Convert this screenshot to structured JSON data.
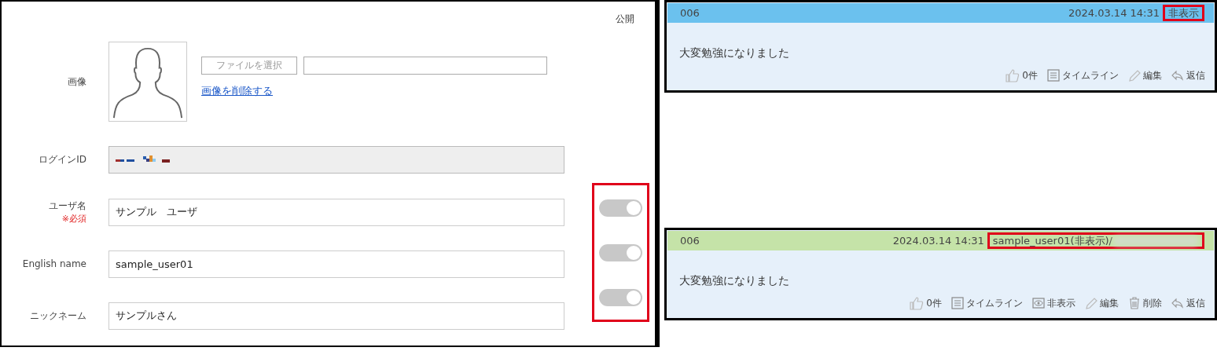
{
  "profile": {
    "public_header": "公開",
    "toggles_highlighted": true,
    "fields": [
      {
        "kind": "image",
        "label": "画像",
        "file_button": "ファイルを選択",
        "delete_link": "画像を削除する"
      },
      {
        "kind": "masked",
        "label": "ログインID"
      },
      {
        "kind": "text",
        "label": "ユーザ名",
        "required": "※必須",
        "value": "サンプル　ユーザ",
        "public": true
      },
      {
        "kind": "text",
        "label": "English name",
        "value": "sample_user01",
        "public": true
      },
      {
        "kind": "text",
        "label": "ニックネーム",
        "value": "サンプルさん",
        "public": true
      }
    ]
  },
  "posts": [
    {
      "number": "006",
      "color": "#6bc1ee",
      "datetime": "2024.03.14 14:31",
      "tag": {
        "text": "非表示",
        "highlighted": true,
        "blurred_suffix": false
      },
      "message": "大変勉強になりました",
      "actions": [
        {
          "kind": "like",
          "label": "0件"
        },
        {
          "kind": "timeline",
          "label": "タイムライン"
        },
        {
          "kind": "edit",
          "label": "編集"
        },
        {
          "kind": "reply",
          "label": "返信"
        }
      ]
    },
    {
      "number": "006",
      "color": "#c5e3a8",
      "datetime": "2024.03.14 14:31",
      "tag": {
        "text": "sample_user01(非表示)/",
        "highlighted": true,
        "blurred_suffix": true
      },
      "message": "大変勉強になりました",
      "actions": [
        {
          "kind": "like",
          "label": "0件"
        },
        {
          "kind": "timeline",
          "label": "タイムライン"
        },
        {
          "kind": "hide",
          "label": "非表示"
        },
        {
          "kind": "edit",
          "label": "編集"
        },
        {
          "kind": "delete",
          "label": "削除"
        },
        {
          "kind": "reply",
          "label": "返信"
        }
      ]
    }
  ]
}
